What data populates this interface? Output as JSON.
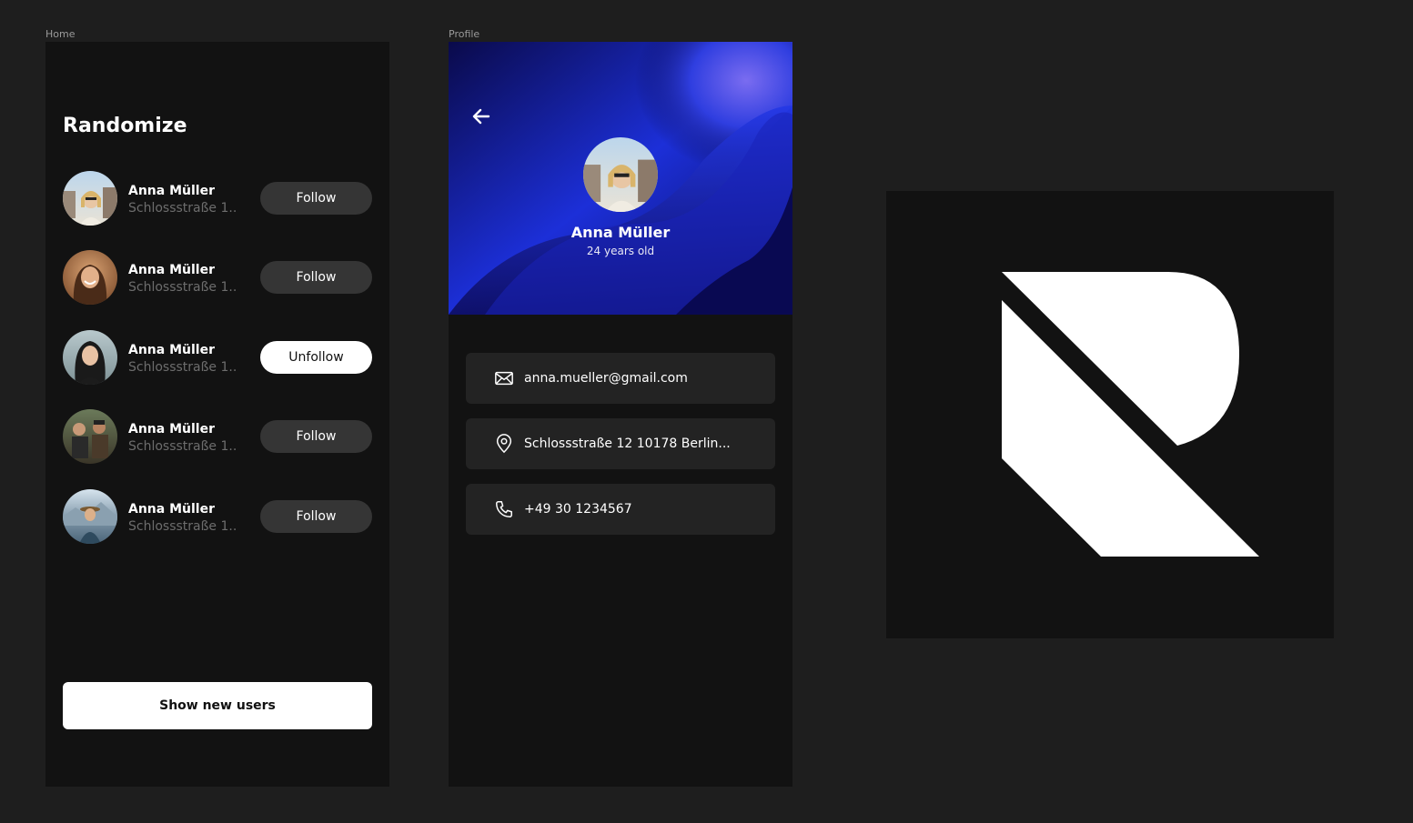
{
  "frames": {
    "home_label": "Home",
    "profile_label": "Profile"
  },
  "home": {
    "title": "Randomize",
    "users": [
      {
        "name": "Anna Müller",
        "address": "Schlossstraße 1...",
        "action": "Follow",
        "following": false,
        "avatar": "user-photo-1"
      },
      {
        "name": "Anna Müller",
        "address": "Schlossstraße 1...",
        "action": "Follow",
        "following": false,
        "avatar": "user-photo-2"
      },
      {
        "name": "Anna Müller",
        "address": "Schlossstraße 1...",
        "action": "Unfollow",
        "following": true,
        "avatar": "user-photo-3"
      },
      {
        "name": "Anna Müller",
        "address": "Schlossstraße 1...",
        "action": "Follow",
        "following": false,
        "avatar": "user-photo-4"
      },
      {
        "name": "Anna Müller",
        "address": "Schlossstraße 1...",
        "action": "Follow",
        "following": false,
        "avatar": "user-photo-5"
      }
    ],
    "show_new_users": "Show new users"
  },
  "profile": {
    "back_icon": "arrow-left-icon",
    "name": "Anna Müller",
    "age": "24 years old",
    "email": "anna.mueller@gmail.com",
    "address": "Schlossstraße 12 10178 Berlin...",
    "phone": "+49 30 1234567",
    "icons": {
      "email": "mail-icon",
      "address": "map-pin-icon",
      "phone": "phone-icon"
    }
  },
  "logo": {
    "icon": "randomize-logo-icon"
  },
  "colors": {
    "canvas": "#1e1e1e",
    "frame": "#121212",
    "card": "#232323",
    "button_dark": "#353535",
    "button_light": "#ffffff",
    "accent_blue": "#1d3cf0"
  }
}
